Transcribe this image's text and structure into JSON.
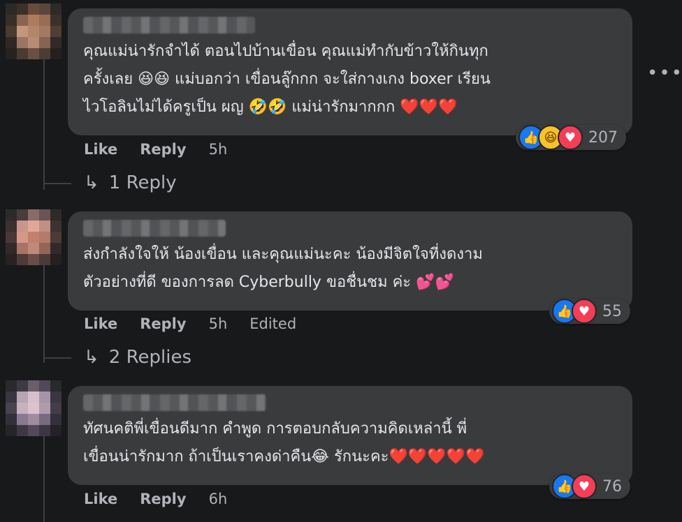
{
  "comments": [
    {
      "text_lines": [
        "คุณแม่น่ารักจำได้ ตอนไปบ้านเขื่อน คุณแม่ทำกับข้าวให้กินทุก",
        "ครั้งเลย 😆😆 แม่บอกว่า เขื่อนลู๊กกก จะใส่กางเกง boxer เรียน",
        "ไวโอลินไม่ได้ครูเป็น ผญ 🤣🤣 แม่น่ารักมากกก ❤️❤️❤️"
      ],
      "reaction_count": "207",
      "reactions": [
        "like-icon",
        "haha-icon",
        "love-icon"
      ],
      "like_label": "Like",
      "reply_label": "Reply",
      "time": "5h",
      "edited": "",
      "replies_label": "1 Reply"
    },
    {
      "text_lines": [
        "ส่งกำลังใจให้ น้องเขื่อน และคุณแม่นะคะ น้องมีจิตใจที่งดงาม",
        "ตัวอย่างที่ดี ของการลด Cyberbully ขอชื่นชม ค่ะ 💕💕"
      ],
      "reaction_count": "55",
      "reactions": [
        "like-icon",
        "love-icon"
      ],
      "like_label": "Like",
      "reply_label": "Reply",
      "time": "5h",
      "edited": "Edited",
      "replies_label": "2 Replies"
    },
    {
      "text_lines": [
        "ทัศนคติพี่เขื่อนดีมาก คำพูด การตอบกลับความคิดเหล่านี้ พี่",
        "เขื่อนน่ารักมาก ถ้าเป็นเราคงด่าคืน😂 รักนะคะ❤️❤️❤️❤️❤️"
      ],
      "reaction_count": "76",
      "reactions": [
        "like-icon",
        "love-icon"
      ],
      "like_label": "Like",
      "reply_label": "Reply",
      "time": "6h",
      "edited": "",
      "replies_label": ""
    }
  ],
  "more_options": "•••",
  "colors": {
    "background": "#18191a",
    "bubble": "#3a3b3c",
    "text": "#e4e6eb",
    "secondary": "#b0b3b8",
    "like": "#1877f2",
    "love": "#f33e58",
    "haha": "#f7c22a"
  }
}
